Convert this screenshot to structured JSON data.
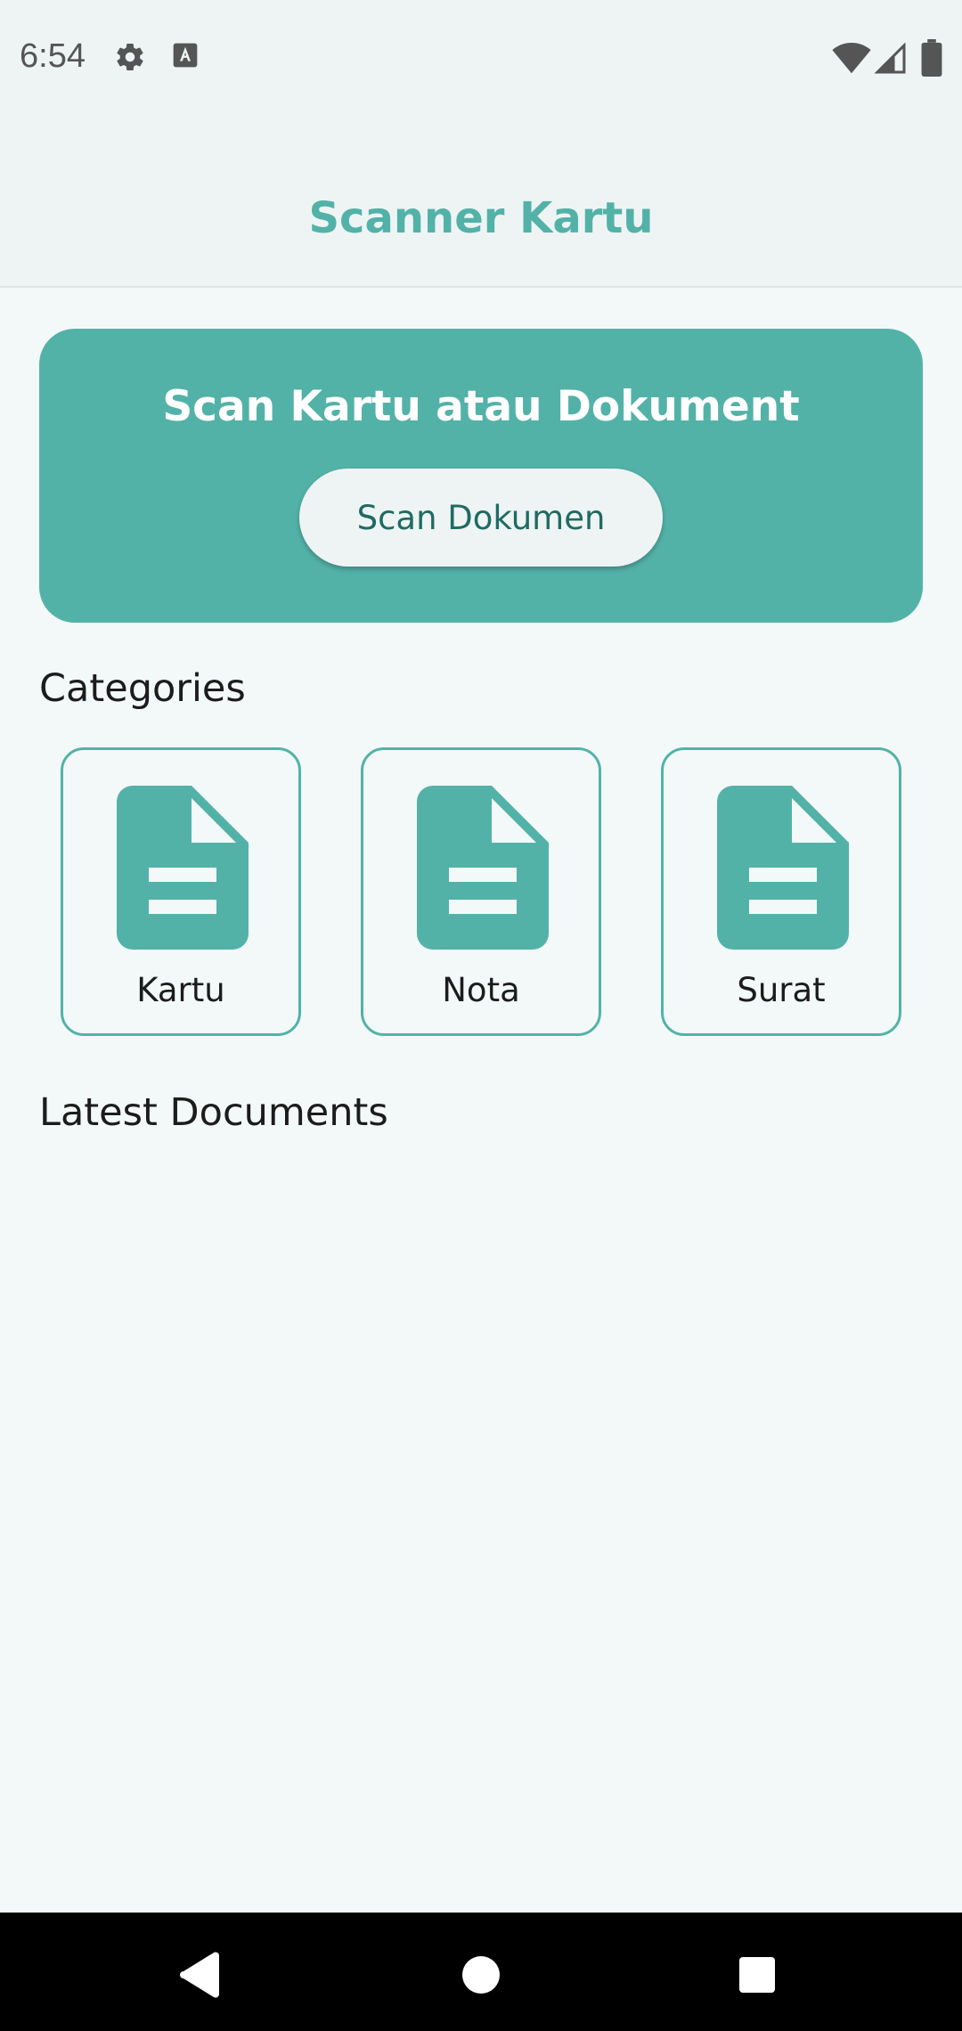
{
  "status_bar": {
    "time": "6:54",
    "icons": [
      "gear-icon",
      "keyboard-a-icon",
      "wifi-icon",
      "signal-icon",
      "battery-icon"
    ]
  },
  "app_bar": {
    "title": "Scanner Kartu"
  },
  "scan_card": {
    "title": "Scan Kartu atau Dokument",
    "button_label": "Scan Dokumen"
  },
  "categories": {
    "title": "Categories",
    "items": [
      {
        "label": "Kartu",
        "icon": "document-icon"
      },
      {
        "label": "Nota",
        "icon": "document-icon"
      },
      {
        "label": "Surat",
        "icon": "document-icon"
      }
    ]
  },
  "latest_documents": {
    "title": "Latest Documents"
  },
  "colors": {
    "accent": "#53b2a8",
    "background": "#f3f9f8",
    "app_bar": "#eef4f4",
    "button_text": "#1f6b62"
  },
  "nav_bar": {
    "icons": [
      "back-icon",
      "home-icon",
      "recents-icon"
    ]
  }
}
